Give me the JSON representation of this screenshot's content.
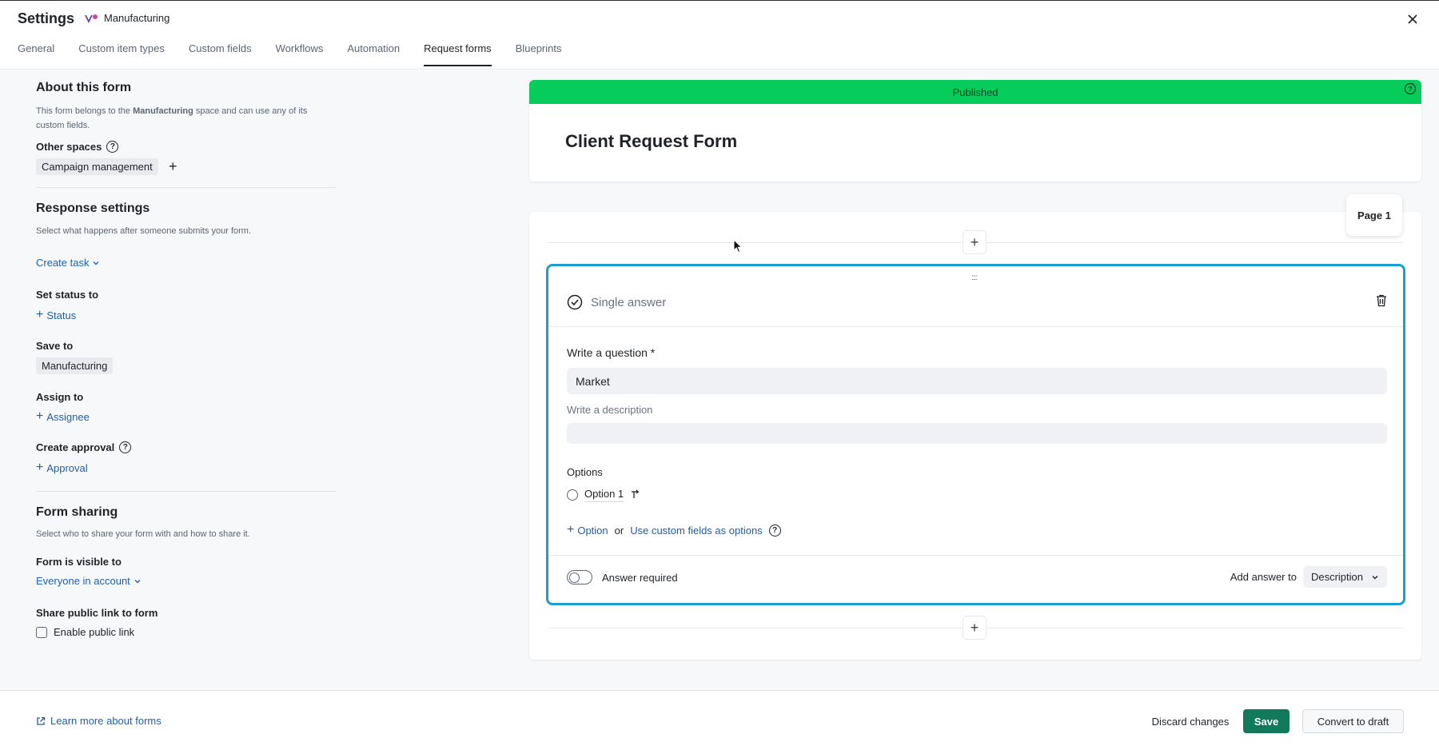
{
  "header": {
    "title": "Settings",
    "space_name": "Manufacturing",
    "tabs": [
      {
        "label": "General"
      },
      {
        "label": "Custom item types"
      },
      {
        "label": "Custom fields"
      },
      {
        "label": "Workflows"
      },
      {
        "label": "Automation"
      },
      {
        "label": "Request forms",
        "active": true
      },
      {
        "label": "Blueprints"
      }
    ]
  },
  "sidebar": {
    "about": {
      "heading": "About this form",
      "desc_pre": "This form belongs to the ",
      "desc_space": "Manufacturing",
      "desc_post": " space and can use any of its",
      "desc_line2": "custom fields.",
      "other_spaces_label": "Other spaces",
      "other_space_chip": "Campaign management"
    },
    "response": {
      "heading": "Response settings",
      "desc": "Select what happens after someone submits your form.",
      "create_task": "Create task",
      "set_status_label": "Set status to",
      "status_link": "Status",
      "save_to_label": "Save to",
      "save_to_chip": "Manufacturing",
      "assign_to_label": "Assign to",
      "assignee_link": "Assignee",
      "create_approval_label": "Create approval",
      "approval_link": "Approval"
    },
    "sharing": {
      "heading": "Form sharing",
      "desc": "Select who to share your form with and how to share it.",
      "visible_label": "Form is visible to",
      "visible_value": "Everyone in account",
      "public_link_label": "Share public link to form",
      "enable_public_link": "Enable public link"
    }
  },
  "form": {
    "status": "Published",
    "title": "Client Request Form",
    "page_label": "Page 1",
    "question": {
      "type_label": "Single answer",
      "question_label": "Write a question *",
      "question_value": "Market",
      "description_label": "Write a description",
      "description_value": "",
      "options_label": "Options",
      "options": [
        "Option 1"
      ],
      "add_option": "Option",
      "or_text": "or",
      "custom_fields_link": "Use custom fields as options",
      "answer_required": "Answer required",
      "add_answer_to_label": "Add answer to",
      "add_answer_to_value": "Description"
    }
  },
  "footer": {
    "learn_more": "Learn more about forms",
    "discard": "Discard changes",
    "save": "Save",
    "convert": "Convert to draft"
  },
  "colors": {
    "published_green": "#06cc5b",
    "accent_blue": "#1a9fd0",
    "link_blue": "#1f5fa8",
    "save_green": "#12795a"
  }
}
